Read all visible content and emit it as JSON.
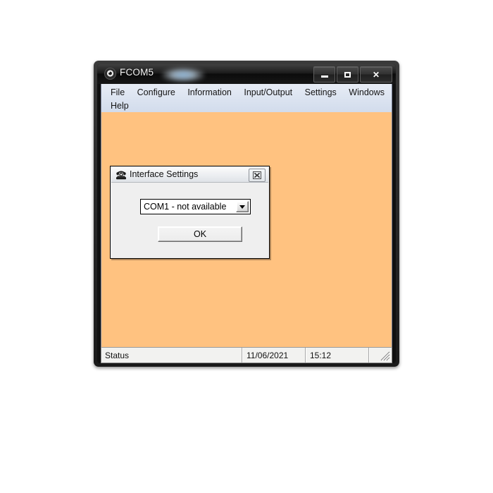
{
  "window": {
    "title": "FCOM5",
    "icon": "app-circle-icon",
    "controls": {
      "minimize": "Minimize",
      "maximize": "Maximize",
      "close": "Close"
    }
  },
  "menu": {
    "row1": [
      {
        "label": "File"
      },
      {
        "label": "Configure"
      },
      {
        "label": "Information"
      },
      {
        "label": "Input/Output"
      },
      {
        "label": "Settings"
      },
      {
        "label": "Windows"
      }
    ],
    "row2": [
      {
        "label": "Help"
      }
    ]
  },
  "client": {
    "background_color": "#ffc280"
  },
  "status_bar": {
    "message": "Status",
    "date": "11/06/2021",
    "time": "15:12",
    "grip": "resize-grip"
  },
  "dialog": {
    "title": "Interface Settings",
    "icon": "telephone-icon",
    "close_label": "☒",
    "port_select": {
      "value": "COM1 - not available",
      "options": [
        "COM1 - not available"
      ]
    },
    "ok_label": "OK"
  },
  "colors": {
    "client_orange": "#ffc280",
    "dialog_face": "#efefef",
    "menu_bar": "#dbe3f0",
    "titlebar_dark": "#1b1b1b",
    "status_face": "#f2f2f0"
  }
}
